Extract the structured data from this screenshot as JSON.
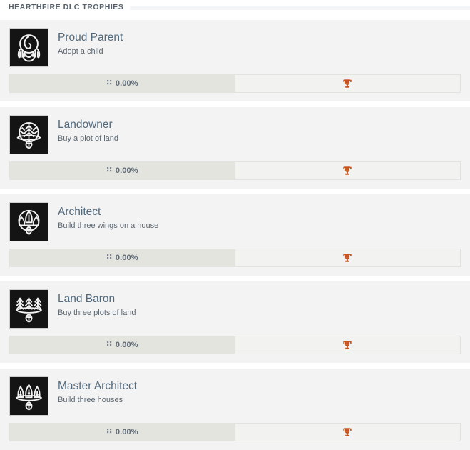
{
  "section": {
    "title": "HEARTHFIRE DLC TROPHIES"
  },
  "colors": {
    "card_background": "#f3f3f3",
    "page_background": "#ffffff",
    "trophy_name": "#51697d",
    "trophy_description": "#5a6671",
    "progress_fill": "#e3e4de",
    "reward_background": "#f2f2f0",
    "reward_icon": "#c4521f",
    "section_title": "#56606b"
  },
  "trophies": [
    {
      "name": "Proud Parent",
      "description": "Adopt a child",
      "progress_label": "0.00%",
      "progress_percent": 0,
      "icon_name": "proud-parent-emblem",
      "reward_icon_name": "trophy-icon"
    },
    {
      "name": "Landowner",
      "description": "Buy a plot of land",
      "progress_label": "0.00%",
      "progress_percent": 0,
      "icon_name": "landowner-emblem",
      "reward_icon_name": "trophy-icon"
    },
    {
      "name": "Architect",
      "description": "Build three wings on a house",
      "progress_label": "0.00%",
      "progress_percent": 0,
      "icon_name": "architect-emblem",
      "reward_icon_name": "trophy-icon"
    },
    {
      "name": "Land Baron",
      "description": "Buy three plots of land",
      "progress_label": "0.00%",
      "progress_percent": 0,
      "icon_name": "land-baron-emblem",
      "reward_icon_name": "trophy-icon"
    },
    {
      "name": "Master Architect",
      "description": "Build three houses",
      "progress_label": "0.00%",
      "progress_percent": 0,
      "icon_name": "master-architect-emblem",
      "reward_icon_name": "trophy-icon"
    }
  ]
}
